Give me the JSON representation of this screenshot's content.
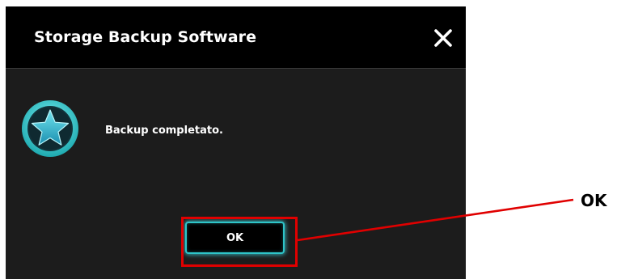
{
  "window": {
    "title": "Storage Backup Software",
    "close_icon": "close-icon"
  },
  "dialog": {
    "status_icon": "star-icon",
    "message": "Backup completato.",
    "ok_label": "OK"
  },
  "annotation": {
    "label": "OK",
    "highlight_color": "#e00000"
  },
  "colors": {
    "titlebar_bg": "#000000",
    "dialog_bg": "#1c1c1c",
    "accent_cyan": "#2ec4c8",
    "text": "#ffffff"
  }
}
